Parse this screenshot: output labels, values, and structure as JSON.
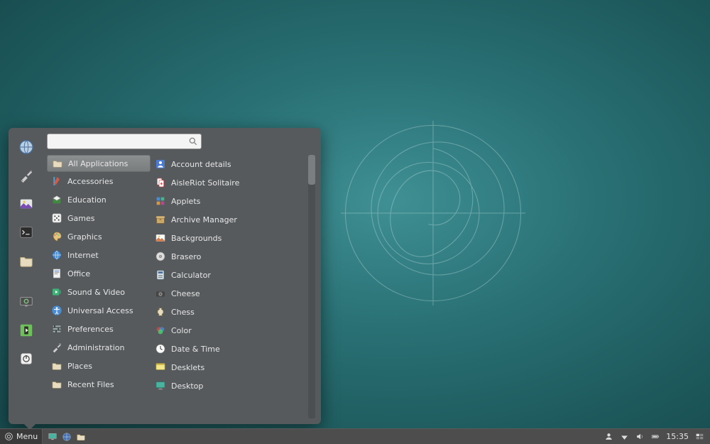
{
  "panel": {
    "menu_label": "Menu",
    "clock": "15:35"
  },
  "menu": {
    "search_placeholder": "",
    "categories": [
      {
        "label": "All Applications",
        "icon": "folder",
        "selected": true
      },
      {
        "label": "Accessories",
        "icon": "accessories"
      },
      {
        "label": "Education",
        "icon": "education"
      },
      {
        "label": "Games",
        "icon": "games"
      },
      {
        "label": "Graphics",
        "icon": "graphics"
      },
      {
        "label": "Internet",
        "icon": "internet"
      },
      {
        "label": "Office",
        "icon": "office"
      },
      {
        "label": "Sound & Video",
        "icon": "sound-video"
      },
      {
        "label": "Universal Access",
        "icon": "universal-access"
      },
      {
        "label": "Preferences",
        "icon": "preferences"
      },
      {
        "label": "Administration",
        "icon": "administration"
      },
      {
        "label": "Places",
        "icon": "folder"
      },
      {
        "label": "Recent Files",
        "icon": "folder"
      }
    ],
    "apps": [
      {
        "label": "Account details",
        "icon": "account"
      },
      {
        "label": "AisleRiot Solitaire",
        "icon": "solitaire"
      },
      {
        "label": "Applets",
        "icon": "applets"
      },
      {
        "label": "Archive Manager",
        "icon": "archive"
      },
      {
        "label": "Backgrounds",
        "icon": "backgrounds"
      },
      {
        "label": "Brasero",
        "icon": "brasero"
      },
      {
        "label": "Calculator",
        "icon": "calculator"
      },
      {
        "label": "Cheese",
        "icon": "cheese"
      },
      {
        "label": "Chess",
        "icon": "chess"
      },
      {
        "label": "Color",
        "icon": "color"
      },
      {
        "label": "Date & Time",
        "icon": "datetime"
      },
      {
        "label": "Desklets",
        "icon": "desklets"
      },
      {
        "label": "Desktop",
        "icon": "desktop"
      }
    ]
  }
}
